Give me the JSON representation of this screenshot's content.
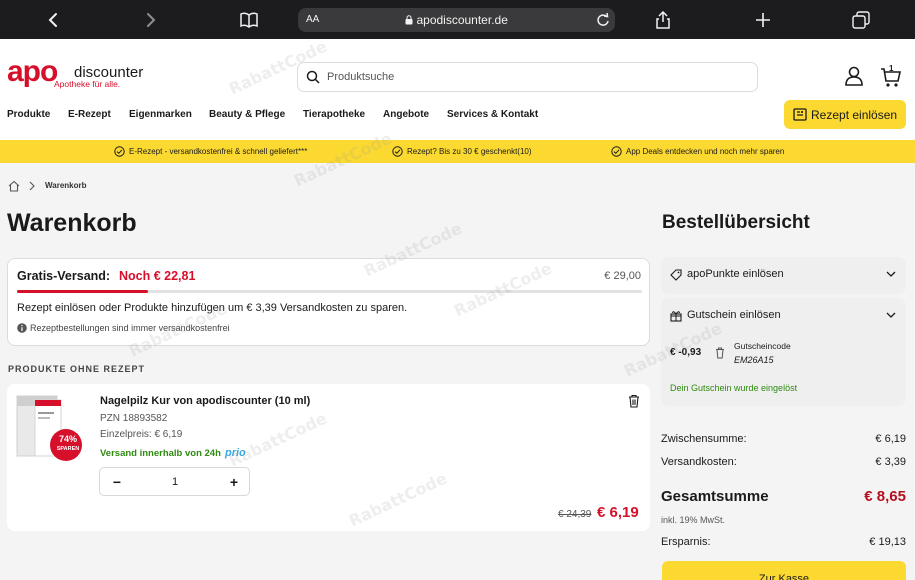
{
  "browser": {
    "url": "apodiscounter.de",
    "text_size_label": "AA"
  },
  "header": {
    "logo_apo": "apo",
    "logo_discounter": "discounter",
    "logo_slogan": "Apotheke für alle.",
    "search_placeholder": "Produktsuche",
    "cart_count": "1",
    "nav": [
      "Produkte",
      "E-Rezept",
      "Eigenmarken",
      "Beauty & Pflege",
      "Tierapotheke",
      "Angebote",
      "Services & Kontakt"
    ],
    "rezept_button": "Rezept einlösen"
  },
  "usp": [
    "E-Rezept - versandkostenfrei & schnell geliefert***",
    "Rezept? Bis zu 30 € geschenkt(10)",
    "App Deals entdecken und noch mehr sparen"
  ],
  "breadcrumb": {
    "current": "Warenkorb"
  },
  "cart": {
    "title": "Warenkorb",
    "shipping": {
      "label": "Gratis-Versand:",
      "remaining": "Noch € 22,81",
      "threshold": "€ 29,00",
      "progress": 0.21,
      "message": "Rezept einlösen oder Produkte hinzufügen um € 3,39 Versandkosten zu sparen.",
      "note": "Rezeptbestellungen sind immer versandkostenfrei"
    },
    "section_label": "PRODUKTE OHNE REZEPT",
    "product": {
      "name": "Nagelpilz Kur von apodiscounter (10 ml)",
      "pzn": "PZN 18893582",
      "unit_price": "Einzelpreis: € 6,19",
      "shipping": "Versand innerhalb von 24h",
      "shipping_badge": "prio",
      "discount_badge": "74%",
      "discount_badge_sub": "SPAREN",
      "quantity": "1",
      "old_price": "€ 24,39",
      "price": "€ 6,19"
    }
  },
  "summary": {
    "title": "Bestellübersicht",
    "apopunkte": "apoPunkte einlösen",
    "voucher": {
      "label": "Gutschein einlösen",
      "amount": "€ -0,93",
      "code_label": "Gutscheincode",
      "code": "EM26A15",
      "success": "Dein Gutschein wurde eingelöst"
    },
    "subtotal_label": "Zwischensumme:",
    "subtotal": "€ 6,19",
    "shipping_label": "Versandkosten:",
    "shipping": "€ 3,39",
    "total_label": "Gesamtsumme",
    "total": "€ 8,65",
    "vat": "inkl. 19% MwSt.",
    "savings_label": "Ersparnis:",
    "savings": "€ 19,13",
    "checkout": "Zur Kasse"
  },
  "colors": {
    "brand_red": "#d6102a",
    "accent_yellow": "#fbd931",
    "success_green": "#2e8b10"
  }
}
